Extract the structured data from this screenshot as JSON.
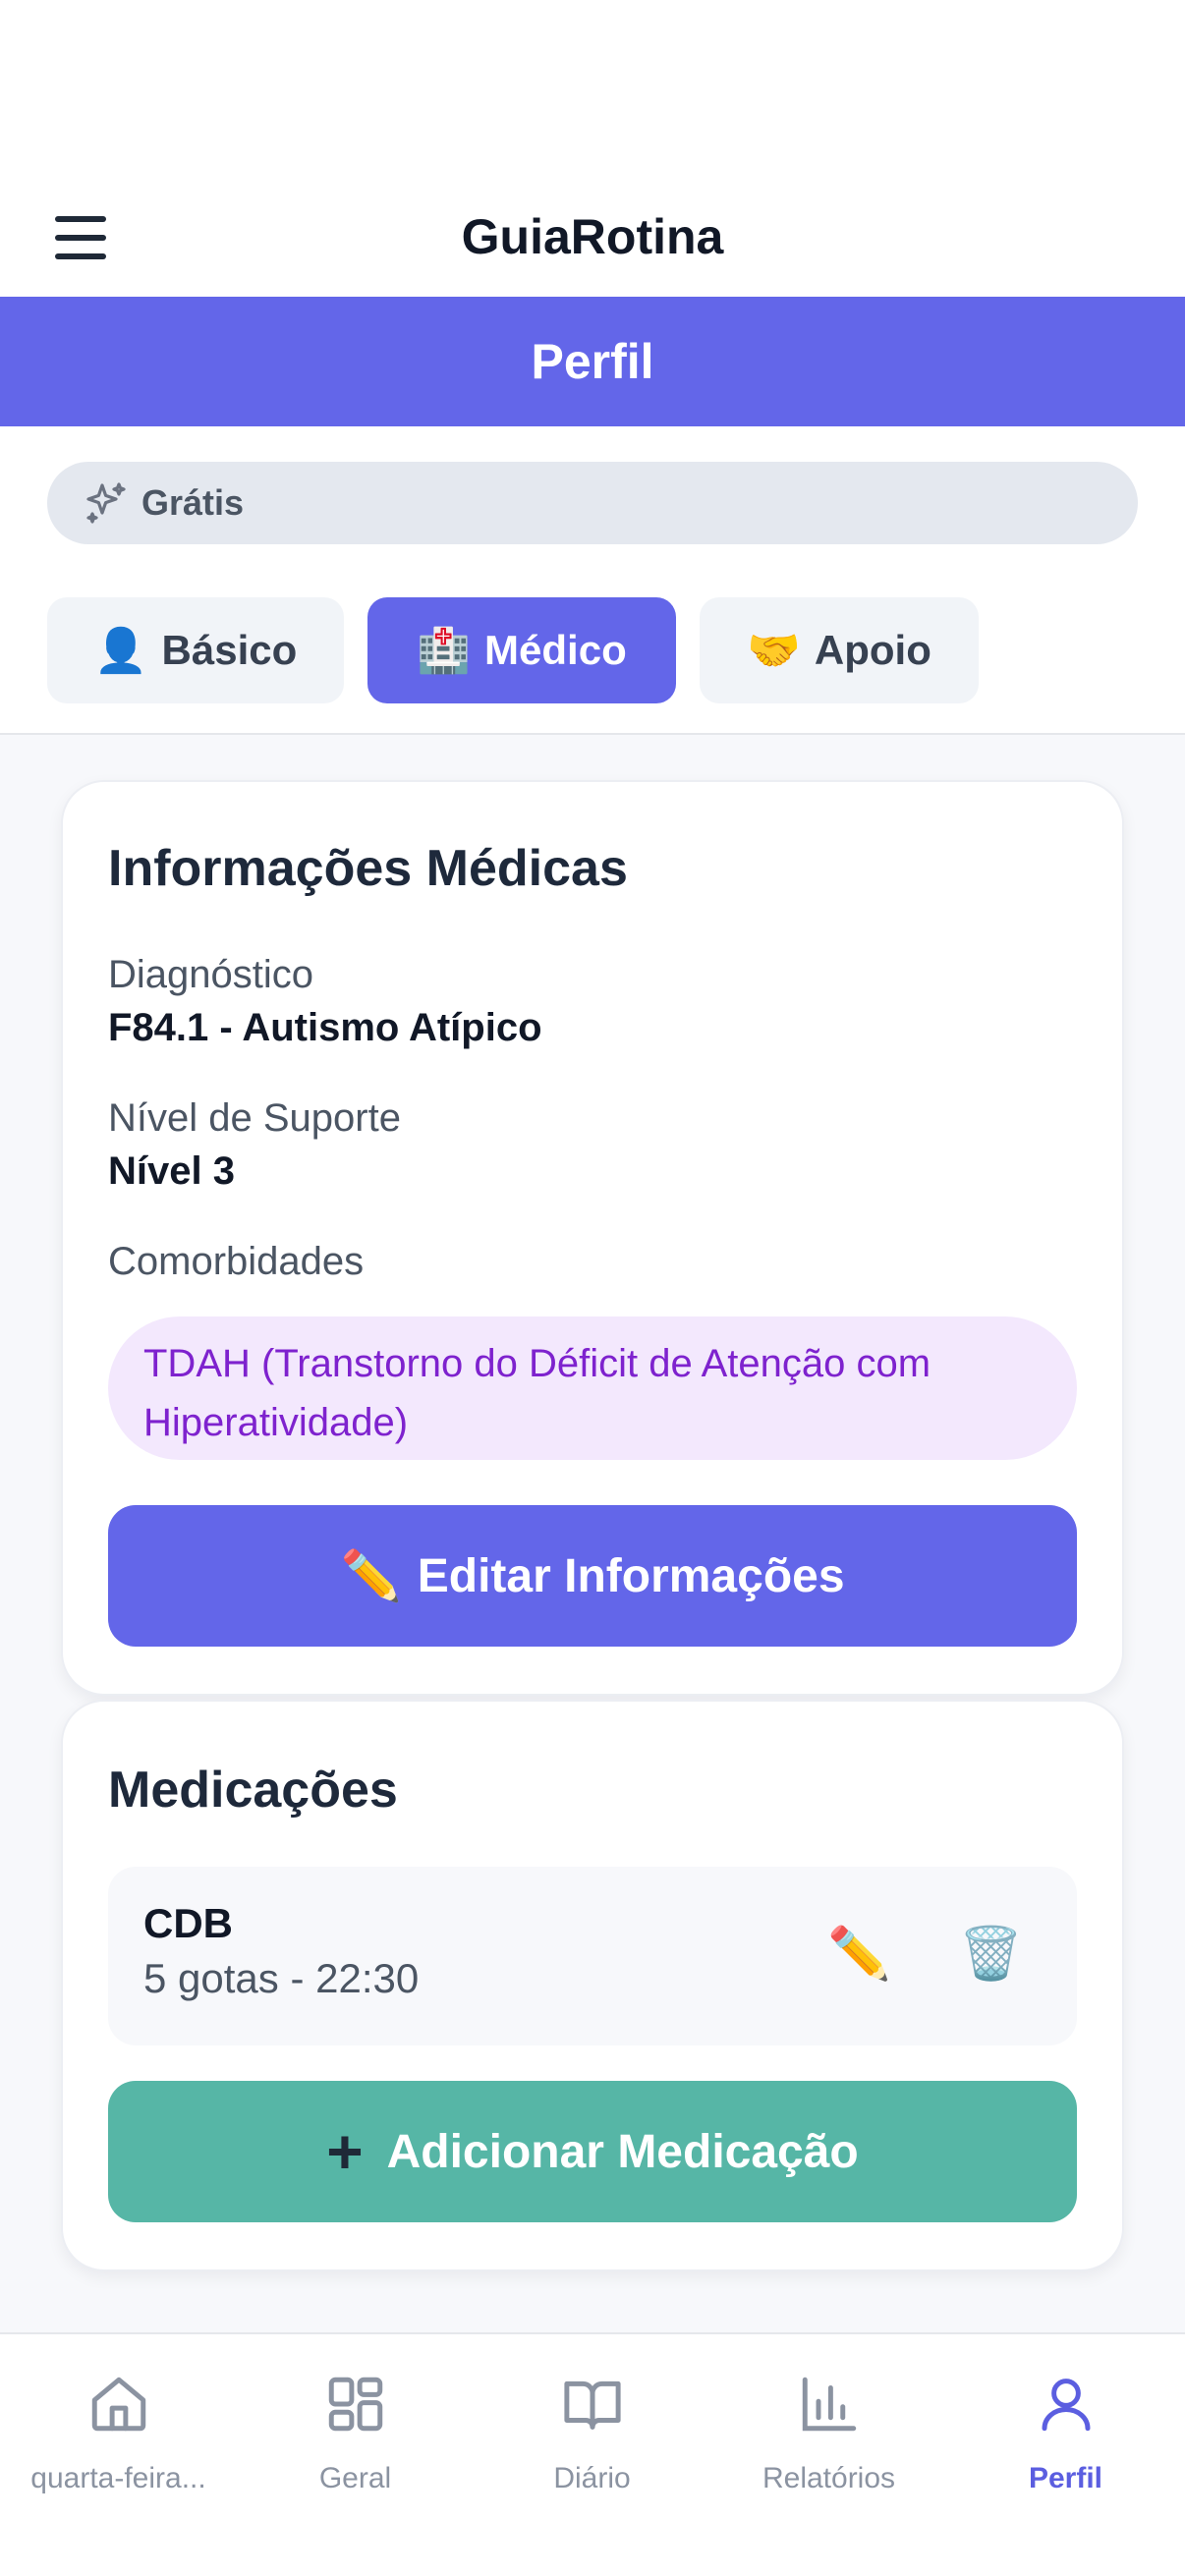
{
  "app": {
    "title": "GuiaRotina"
  },
  "header": {
    "title": "Perfil"
  },
  "plan": {
    "label": "Grátis",
    "icon": "sparkles-icon"
  },
  "tabs": [
    {
      "emoji": "👤",
      "label": "Básico",
      "active": false
    },
    {
      "emoji": "🏥",
      "label": "Médico",
      "active": true
    },
    {
      "emoji": "🤝",
      "label": "Apoio",
      "active": false
    }
  ],
  "medical_info": {
    "title": "Informações Médicas",
    "diagnosis_label": "Diagnóstico",
    "diagnosis_value": "F84.1 - Autismo Atípico",
    "support_label": "Nível de Suporte",
    "support_value": "Nível 3",
    "comorbidities_label": "Comorbidades",
    "comorbidities": [
      "TDAH (Transtorno do Déficit de Atenção com Hiperatividade)"
    ],
    "edit_emoji": "✏️",
    "edit_label": "Editar Informações"
  },
  "medications": {
    "title": "Medicações",
    "items": [
      {
        "name": "CDB",
        "detail": "5 gotas - 22:30",
        "edit_emoji": "✏️",
        "delete_emoji": "🗑️"
      }
    ],
    "add_symbol": "+",
    "add_label": "Adicionar Medicação"
  },
  "bottom_nav": {
    "items": [
      {
        "label": "quarta-feira...",
        "icon": "home-icon",
        "active": false
      },
      {
        "label": "Geral",
        "icon": "grid-icon",
        "active": false
      },
      {
        "label": "Diário",
        "icon": "book-icon",
        "active": false
      },
      {
        "label": "Relatórios",
        "icon": "bar-chart-icon",
        "active": false
      },
      {
        "label": "Perfil",
        "icon": "user-icon",
        "active": true
      }
    ]
  },
  "colors": {
    "primary": "#6366e9",
    "accent_green": "#56b6a6",
    "comorbidity_text": "#7e22ce",
    "comorbidity_bg": "#f3e8fd"
  }
}
